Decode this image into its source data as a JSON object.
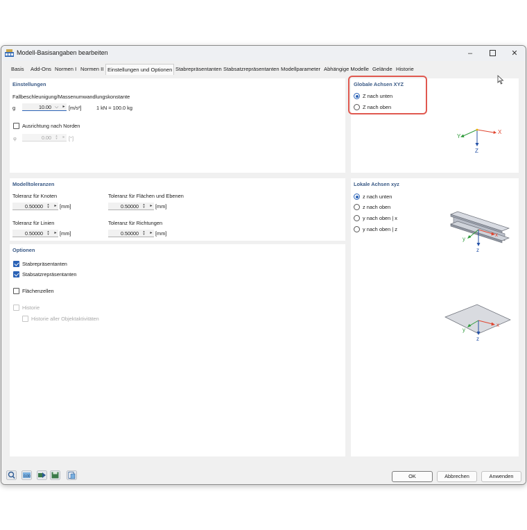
{
  "window": {
    "title": "Modell-Basisangaben bearbeiten",
    "minimize_icon": "minimize-icon",
    "maximize_icon": "maximize-icon",
    "close_icon": "close-icon"
  },
  "tabs": [
    {
      "label": "Basis"
    },
    {
      "label": "Add-Ons"
    },
    {
      "label": "Normen I"
    },
    {
      "label": "Normen II"
    },
    {
      "label": "Einstellungen und Optionen",
      "active": true
    },
    {
      "label": "Stabrepräsentanten"
    },
    {
      "label": "Stabsatzrepräsentanten"
    },
    {
      "label": "Modellparameter"
    },
    {
      "label": "Abhängige Modelle"
    },
    {
      "label": "Gelände"
    },
    {
      "label": "Historie"
    }
  ],
  "einstellungen": {
    "title": "Einstellungen",
    "fall_label": "Fallbeschleunigung/Massenumwandlungskonstante",
    "g_label": "g",
    "g_value": "10.00",
    "g_unit": "[m/s²]",
    "conversion": "1 kN = 100.0 kg",
    "north_label": "Ausrichtung nach Norden",
    "north_checked": false,
    "phi_label": "φ",
    "phi_value": "0.00",
    "phi_unit": "[°]"
  },
  "globale_achsen": {
    "title": "Globale Achsen XYZ",
    "options": [
      "Z nach unten",
      "Z nach oben"
    ],
    "selected": 0,
    "axis_x": "X",
    "axis_y": "Y",
    "axis_z": "Z"
  },
  "modelltoleranzen": {
    "title": "Modelltoleranzen",
    "knoten_label": "Toleranz für Knoten",
    "knoten_value": "0.50000",
    "flaechen_label": "Toleranz für Flächen und Ebenen",
    "flaechen_value": "0.50000",
    "linien_label": "Toleranz für Linien",
    "linien_value": "0.50000",
    "richtungen_label": "Toleranz für Richtungen",
    "richtungen_value": "0.50000",
    "unit": "[mm]"
  },
  "optionen": {
    "title": "Optionen",
    "stabrep": "Stabrepräsentanten",
    "stabsatzrep": "Stabsatzrepräsentanten",
    "flaechenzellen": "Flächenzellen",
    "historie": "Historie",
    "historie_alle": "Historie aller Objektaktivitäten"
  },
  "lokale_achsen": {
    "title": "Lokale Achsen xyz",
    "options": [
      "z nach unten",
      "z nach oben",
      "y nach oben | x",
      "y nach oben | z"
    ],
    "selected": 0,
    "axis_x": "x",
    "axis_y": "y",
    "axis_z": "z"
  },
  "footer": {
    "ok": "OK",
    "cancel": "Abbrechen",
    "apply": "Anwenden"
  },
  "colors": {
    "accent": "#2a62b6",
    "section_title": "#3a5a86",
    "highlight": "#e0584f",
    "axis_x": "#e0452f",
    "axis_y": "#2e9a3a",
    "axis_z": "#2451a6"
  }
}
